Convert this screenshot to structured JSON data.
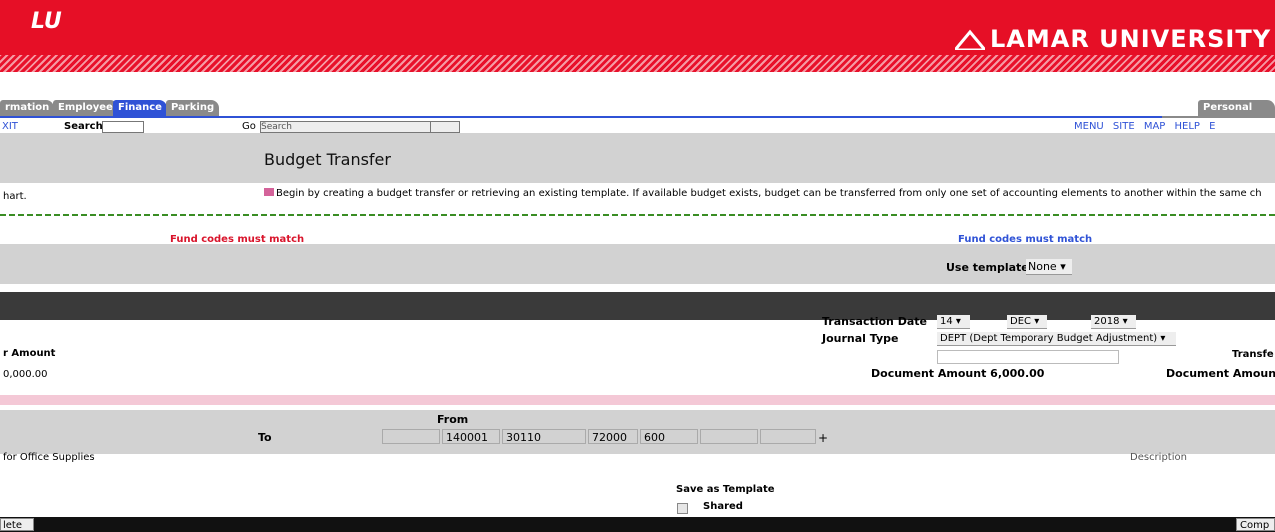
{
  "header": {
    "logo_mark": "LU",
    "brand_right": "LAMAR UNIVERSITY"
  },
  "tabs": [
    {
      "label": "rmation"
    },
    {
      "label": "Employee"
    },
    {
      "label": "Finance"
    },
    {
      "label": "Parking"
    }
  ],
  "right_tab": "Personal Info",
  "linkrow": {
    "exit": "XIT",
    "search_label": "Search",
    "go_label": "Go",
    "search2_placeholder": "Search",
    "top_links": "MENU  SITE MAP  HELP  E"
  },
  "page_title": "Budget Transfer",
  "intro": {
    "left": "hart.",
    "text": "Begin by creating a budget transfer or retrieving an existing template. If available budget exists, budget can be transferred from only one set of accounting elements to another within the same ch"
  },
  "notice": {
    "fund_codes_left": "Fund codes must match",
    "fund_codes_right": "Fund codes must match"
  },
  "template": {
    "label": "Use template",
    "value": "None"
  },
  "transaction": {
    "date_label": "Transaction Date",
    "day": "14",
    "month": "DEC",
    "year": "2018",
    "journal_type_label": "Journal Type",
    "journal_type_value": "DEPT (Dept Temporary Budget Adjustment)",
    "amount_label_left": "r Amount",
    "amount_left_value": "0,000.00",
    "document_amount": "Document Amount 6,000.00",
    "document_amount_right": "Document Amoun",
    "transfer_right": "Transfe"
  },
  "accounts": {
    "from_label": "From",
    "to_label": "To",
    "to_values": [
      "140001",
      "30110",
      "72000",
      "600"
    ]
  },
  "description": {
    "left": "for Office Supplies",
    "right": "Description"
  },
  "save_template": {
    "label": "Save as Template",
    "shared_label": "Shared"
  },
  "buttons": {
    "delete": "lete",
    "complete": "Comp"
  }
}
